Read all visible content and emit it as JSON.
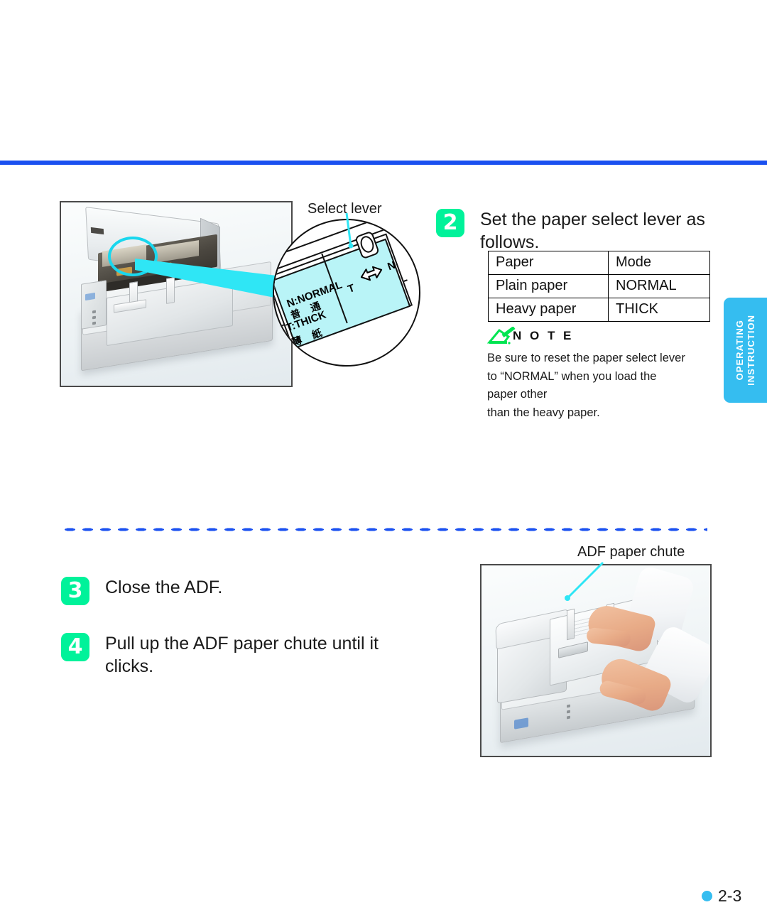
{
  "page": {
    "number": "2-3",
    "side_tab": {
      "line1": "OPERATING",
      "line2": "INSTRUCTION",
      "color": "#35bdf0"
    },
    "rule_color": "#1a50f0",
    "accent_green": "#00f29a",
    "accent_cyan": "#19d7ee"
  },
  "figures": {
    "scanner_open": {
      "caption": "Select lever",
      "highlight": "cyan-circle"
    },
    "magnifier": {
      "label_normal": "N:NORMAL",
      "label_normal_jp": "普 通",
      "label_thick": "T:THICK",
      "label_thick_jp": "薄 紙",
      "arrow_left": "T",
      "arrow_right": "N"
    },
    "adf_chute_photo": {
      "caption": "ADF paper chute"
    }
  },
  "steps": [
    {
      "number": "2",
      "text": "Set the paper select lever as follows."
    },
    {
      "number": "3",
      "text": "Close the ADF."
    },
    {
      "number": "4",
      "text": "Pull up the ADF paper chute until it clicks."
    }
  ],
  "table": {
    "headers": [
      "Paper",
      "Mode"
    ],
    "rows": [
      [
        "Plain paper",
        "NORMAL"
      ],
      [
        "Heavy paper",
        "THICK"
      ]
    ]
  },
  "note": {
    "title": "N O T E",
    "lines": [
      "Be sure to reset the paper select lever",
      "to “NORMAL” when you load the",
      "paper other",
      "than the heavy paper."
    ]
  }
}
